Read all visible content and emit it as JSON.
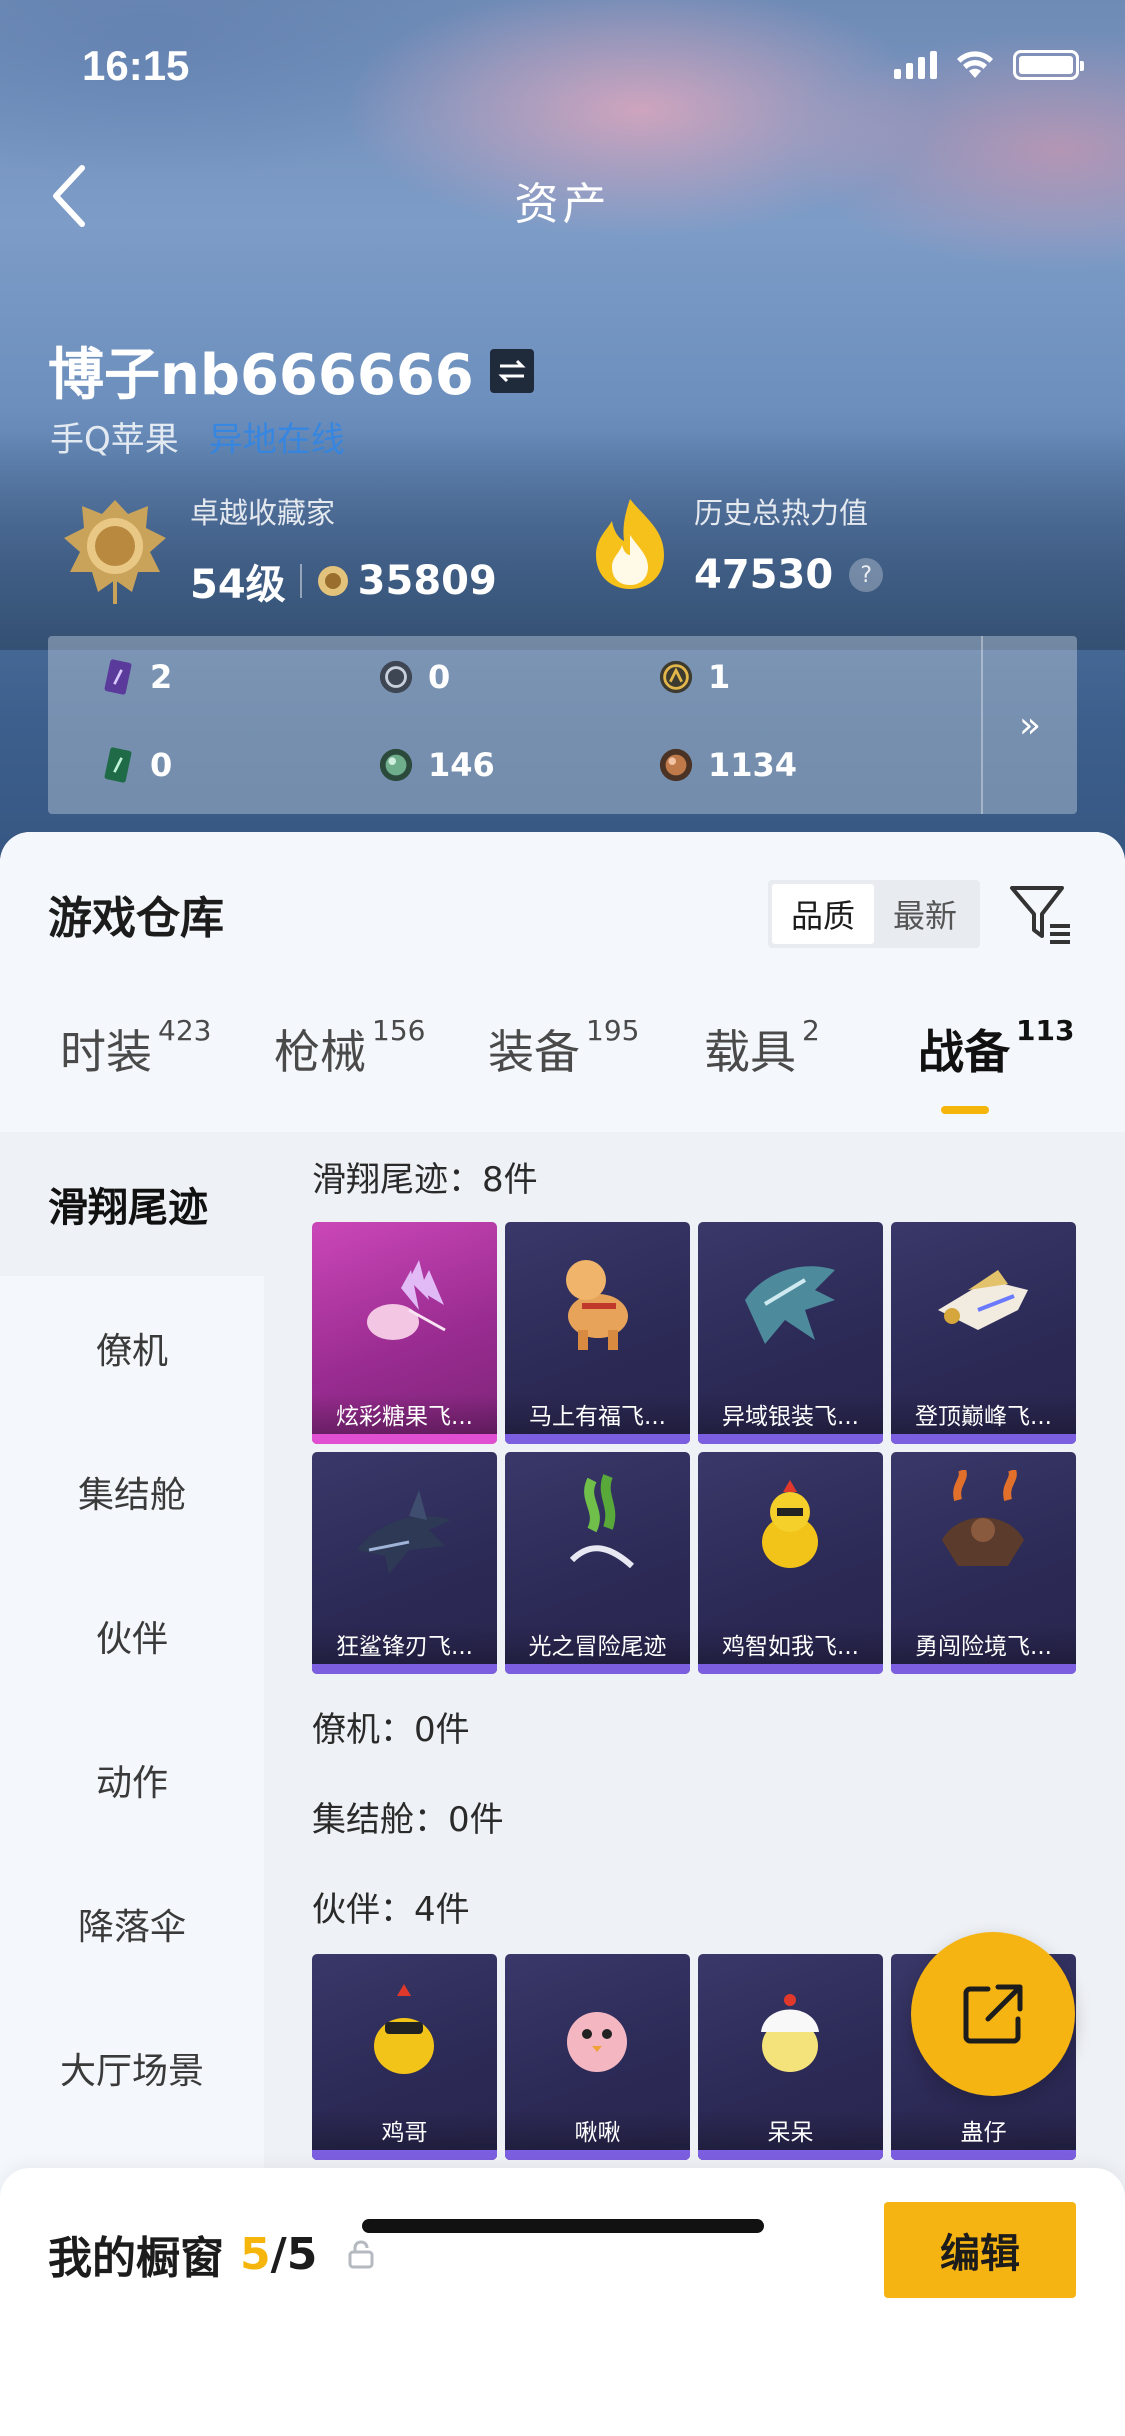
{
  "status_bar": {
    "time": "16:15"
  },
  "nav": {
    "title": "资产"
  },
  "profile": {
    "name": "博子nb666666",
    "platform": "手Q苹果",
    "other_login": "异地在线"
  },
  "collector": {
    "label": "卓越收藏家",
    "level": "54级",
    "points": "35809"
  },
  "heat": {
    "label": "历史总热力值",
    "value": "47530",
    "help": "?"
  },
  "currencies": [
    {
      "icon": "purple-card-icon",
      "value": "2"
    },
    {
      "icon": "silver-coin-icon",
      "value": "0"
    },
    {
      "icon": "gold-coin-icon",
      "value": "1"
    },
    {
      "icon": "green-card-icon",
      "value": "0"
    },
    {
      "icon": "green-orb-icon",
      "value": "146"
    },
    {
      "icon": "bronze-orb-icon",
      "value": "1134"
    }
  ],
  "more_label": "»",
  "warehouse": {
    "title": "游戏仓库",
    "sort": [
      "品质",
      "最新"
    ],
    "tabs": [
      {
        "label": "时装",
        "count": "423"
      },
      {
        "label": "枪械",
        "count": "156"
      },
      {
        "label": "装备",
        "count": "195"
      },
      {
        "label": "载具",
        "count": "2"
      },
      {
        "label": "战备",
        "count": "113"
      }
    ]
  },
  "side_nav": [
    "滑翔尾迹",
    "僚机",
    "集结舱",
    "伙伴",
    "动作",
    "降落伞",
    "大厅场景"
  ],
  "sections": {
    "trail": {
      "title": "滑翔尾迹：8件",
      "items": [
        "炫彩糖果飞...",
        "马上有福飞...",
        "异域银装飞...",
        "登顶巅峰飞...",
        "狂鲨锋刃飞...",
        "光之冒险尾迹",
        "鸡智如我飞...",
        "勇闯险境飞..."
      ]
    },
    "wingman": {
      "title": "僚机：0件"
    },
    "pod": {
      "title": "集结舱：0件"
    },
    "partner": {
      "title": "伙伴：4件",
      "items": [
        "鸡哥",
        "啾啾",
        "呆呆",
        "蛊仔"
      ]
    }
  },
  "showcase": {
    "title": "我的橱窗",
    "current": "5",
    "total": "/5"
  },
  "edit_label": "编辑",
  "colors": {
    "accent": "#f6b413",
    "card_bg": "#2c2a56",
    "card_pink": "#cb47b8",
    "link": "#2f86e8"
  }
}
